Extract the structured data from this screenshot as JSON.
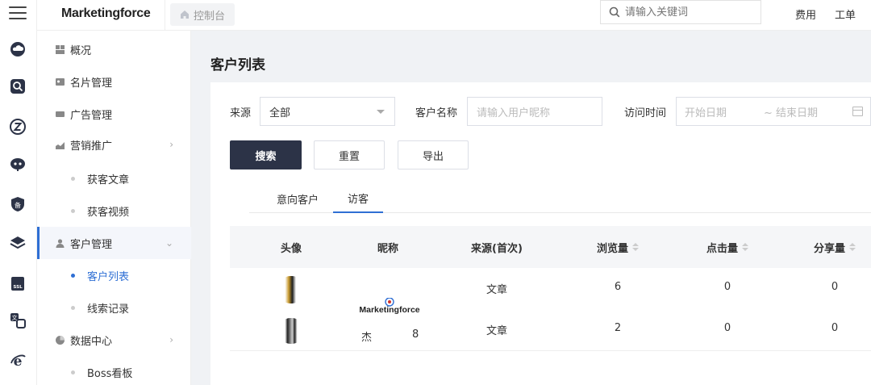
{
  "header": {
    "logo_text": "Marketingforce",
    "breadcrumb": "控制台",
    "search_placeholder": "请输入关键词",
    "links": [
      "费用",
      "工单"
    ]
  },
  "rail": {
    "icons": [
      "menu-icon",
      "cloud-icon",
      "search-box-icon",
      "z-circle-icon",
      "robot-icon",
      "shield-record-icon",
      "layers-icon",
      "ssl-icon",
      "translate-icon",
      "ie-icon"
    ]
  },
  "sidebar": {
    "items": [
      {
        "label": "概况",
        "icon": "overview-icon"
      },
      {
        "label": "名片管理",
        "icon": "card-icon"
      },
      {
        "label": "广告管理",
        "icon": "ad-icon"
      },
      {
        "label": "营销推广",
        "icon": "chart-icon"
      },
      {
        "label": "获客文章"
      },
      {
        "label": "获客视频"
      },
      {
        "label": "客户管理",
        "icon": "customers-icon"
      },
      {
        "label": "客户列表"
      },
      {
        "label": "线索记录"
      },
      {
        "label": "数据中心",
        "icon": "data-icon"
      },
      {
        "label": "Boss看板"
      }
    ]
  },
  "main": {
    "title": "客户列表",
    "filters": {
      "source_label": "来源",
      "source_value": "全部",
      "name_label": "客户名称",
      "name_placeholder": "请输入用户昵称",
      "time_label": "访问时间",
      "start_placeholder": "开始日期",
      "end_placeholder": "~ 结束日期"
    },
    "buttons": {
      "search": "搜索",
      "reset": "重置",
      "export": "导出"
    },
    "tabs": [
      "意向客户",
      "访客"
    ],
    "active_tab": 1,
    "table": {
      "columns": [
        "头像",
        "昵称",
        "来源(首次)",
        "浏览量",
        "点击量",
        "分享量"
      ],
      "rows": [
        {
          "source": "文章",
          "views": "6",
          "clicks": "0",
          "shares": "0"
        },
        {
          "source": "文章",
          "views": "2",
          "clicks": "0",
          "shares": "0"
        }
      ],
      "nickname_fragments": [
        "杰",
        "8"
      ]
    }
  },
  "colors": {
    "accent": "#2f6fd4",
    "primary_button": "#2c3347",
    "page_bg": "#f0f2f5"
  }
}
